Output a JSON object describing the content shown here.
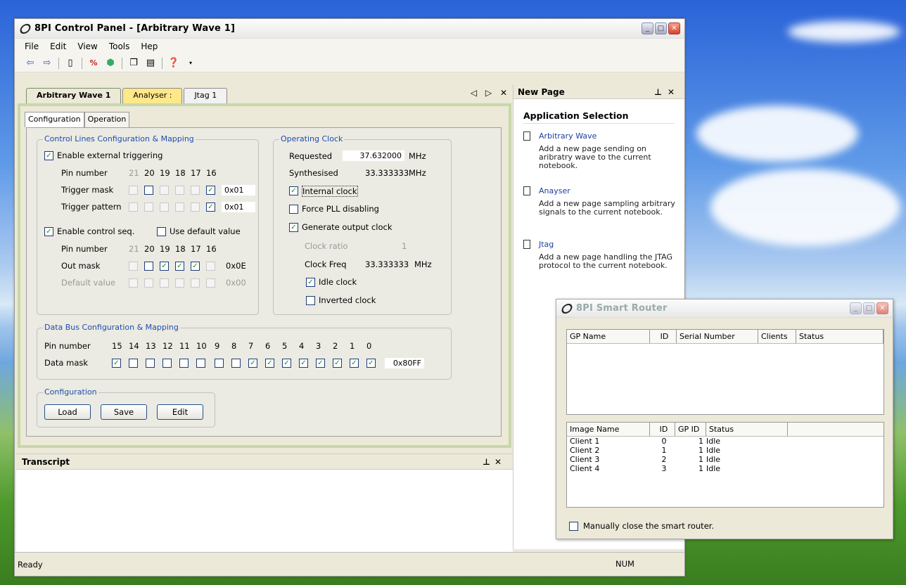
{
  "main_window": {
    "title": "8PI Control Panel - [Arbitrary Wave 1]",
    "menu": [
      "File",
      "Edit",
      "View",
      "Tools",
      "Hep"
    ],
    "doc_tabs": [
      "Arbitrary Wave 1",
      "Analyser :",
      "Jtag 1"
    ],
    "doc_nav": "◁ ▷ ✕",
    "page_tabs": [
      "Configuration",
      "Operation"
    ],
    "control_lines": {
      "legend": "Control Lines Configuration & Mapping",
      "enable_ext_trigger": "Enable external triggering",
      "pin_label": "Pin number",
      "pins_a": [
        "21",
        "20",
        "19",
        "18",
        "17",
        "16"
      ],
      "trigger_mask_label": "Trigger mask",
      "trigger_mask_value": "0x01",
      "trigger_pattern_label": "Trigger pattern",
      "trigger_pattern_value": "0x01",
      "enable_control_seq": "Enable control seq.",
      "use_default_value": "Use default value",
      "pins_b": [
        "21",
        "20",
        "19",
        "18",
        "17",
        "16"
      ],
      "out_mask_label": "Out mask",
      "out_mask_value": "0x0E",
      "default_value_label": "Default value",
      "default_value_value": "0x00"
    },
    "operating_clock": {
      "legend": "Operating Clock",
      "requested_label": "Requested",
      "requested_value": "37.632000",
      "requested_unit": "MHz",
      "synth_label": "Synthesised",
      "synth_value": "33.333333",
      "synth_unit": "MHz",
      "internal_clock": "Internal clock",
      "force_pll": "Force PLL disabling",
      "gen_output": "Generate output clock",
      "ratio_label": "Clock ratio",
      "ratio_value": "1",
      "freq_label": "Clock Freq",
      "freq_value": "33.333333",
      "freq_unit": "MHz",
      "idle_clock": "Idle clock",
      "inverted_clock": "Inverted clock"
    },
    "data_bus": {
      "legend": "Data Bus Configuration & Mapping",
      "pin_label": "Pin number",
      "pins": [
        "15",
        "14",
        "13",
        "12",
        "11",
        "10",
        "9",
        "8",
        "7",
        "6",
        "5",
        "4",
        "3",
        "2",
        "1",
        "0"
      ],
      "mask_label": "Data mask",
      "mask_value": "0x80FF"
    },
    "configuration": {
      "legend": "Configuration",
      "load": "Load",
      "save": "Save",
      "edit": "Edit"
    },
    "transcript_title": "Transcript",
    "status_ready": "Ready",
    "status_num": "NUM"
  },
  "new_page": {
    "title": "New Page",
    "section": "Application Selection",
    "apps": [
      {
        "name": "Arbitrary Wave",
        "desc": "Add a new page sending on aribratry wave to the current notebook."
      },
      {
        "name": "Anayser",
        "desc": "Add a new page sampling arbitrary signals to the current notebook."
      },
      {
        "name": "Jtag",
        "desc": "Add a new page handling the JTAG protocol to the current notebook."
      }
    ]
  },
  "router": {
    "title": "8PI Smart Router",
    "top_columns": [
      "GP Name",
      "ID",
      "Serial Number",
      "Clients",
      "Status"
    ],
    "bottom_columns": [
      "Image Name",
      "ID",
      "GP ID",
      "Status"
    ],
    "rows": [
      {
        "name": "Client 1",
        "id": "0",
        "gpid": "1",
        "status": "Idle"
      },
      {
        "name": "Client 2",
        "id": "1",
        "gpid": "1",
        "status": "Idle"
      },
      {
        "name": "Client 3",
        "id": "2",
        "gpid": "1",
        "status": "Idle"
      },
      {
        "name": "Client 4",
        "id": "3",
        "gpid": "1",
        "status": "Idle"
      }
    ],
    "manual_close": "Manually close the smart router."
  }
}
